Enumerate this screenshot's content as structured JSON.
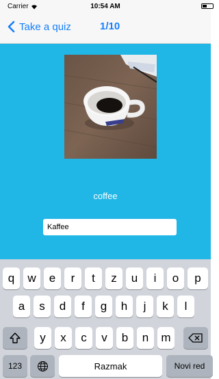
{
  "status_bar": {
    "carrier": "Carrier",
    "time": "10:54 AM"
  },
  "nav": {
    "back_label": "Take a quiz",
    "title": "1/10"
  },
  "quiz": {
    "word": "coffee",
    "answer_value": "Kaffee"
  },
  "keyboard": {
    "row1": [
      "q",
      "w",
      "e",
      "r",
      "t",
      "z",
      "u",
      "i",
      "o",
      "p"
    ],
    "row2": [
      "a",
      "s",
      "d",
      "f",
      "g",
      "h",
      "j",
      "k",
      "l"
    ],
    "row3": [
      "y",
      "x",
      "c",
      "v",
      "b",
      "n",
      "m"
    ],
    "numbers_label": "123",
    "space_label": "Razmak",
    "return_label": "Novi red"
  },
  "colors": {
    "accent": "#147efb",
    "content_bg": "#20b6e6",
    "keyboard_bg": "#d1d5db"
  }
}
